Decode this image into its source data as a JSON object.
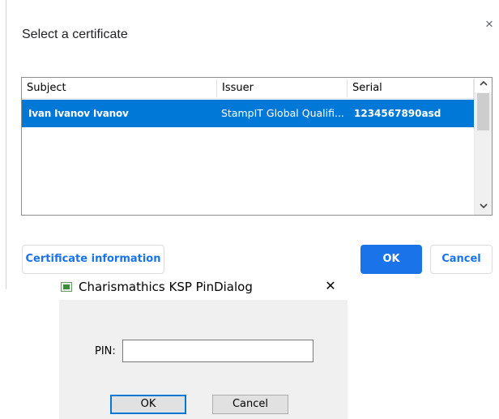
{
  "cert_dialog": {
    "title": "Select a certificate",
    "close_glyph": "×",
    "table": {
      "columns": [
        "Subject",
        "Issuer",
        "Serial"
      ],
      "rows": [
        {
          "subject": "Ivan Ivanov Ivanov",
          "issuer": "StampIT Global Qualifi...",
          "serial": "1234567890asd",
          "selected": true
        }
      ]
    },
    "scroll_up_glyph": "▲",
    "scroll_down_glyph": "▼",
    "buttons": {
      "certificate_information": "Certificate information",
      "ok": "OK",
      "cancel": "Cancel"
    },
    "colors": {
      "accent": "#1a73e8",
      "selection": "#0078d7"
    }
  },
  "pin_dialog": {
    "title": "Charismathics KSP PinDialog",
    "close_glyph": "✕",
    "pin_label": "PIN:",
    "pin_value": "",
    "buttons": {
      "ok": "OK",
      "cancel": "Cancel"
    }
  }
}
